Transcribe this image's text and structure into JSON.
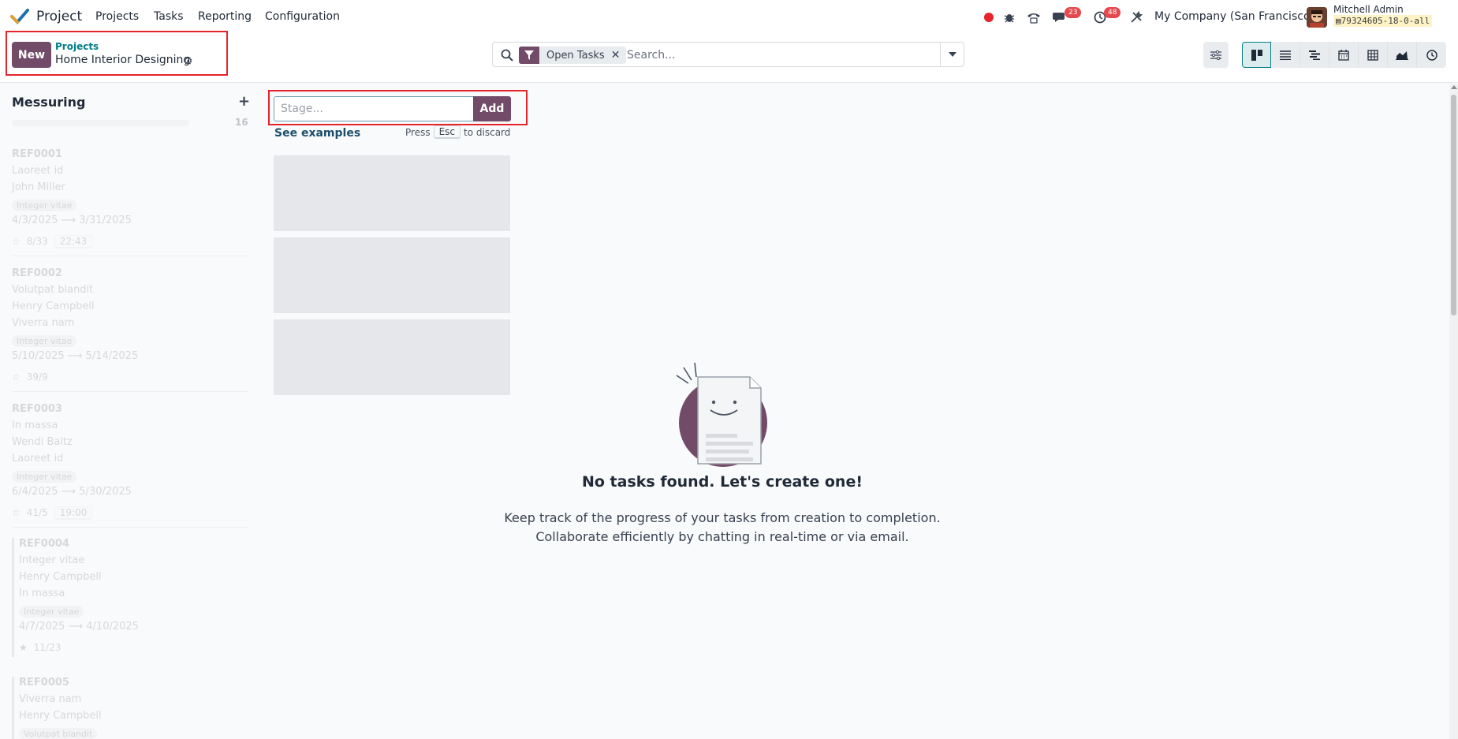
{
  "navbar": {
    "app_name": "Project",
    "menu": [
      "Projects",
      "Tasks",
      "Reporting",
      "Configuration"
    ],
    "messages_count": "23",
    "activities_count": "48",
    "company": "My Company (San Francisco)",
    "user_name": "Mitchell Admin",
    "database": "79324605-18-0-all"
  },
  "control_panel": {
    "new_label": "New",
    "breadcrumb_parent": "Projects",
    "breadcrumb_current": "Home Interior Designing",
    "search": {
      "facet_label": "Open Tasks",
      "placeholder": "Search..."
    }
  },
  "column": {
    "title": "Messuring",
    "count": "16",
    "cards": [
      {
        "ref": "REF0001",
        "line1": "Laoreet id",
        "line2": "John Miller",
        "tag": "Integer vitae",
        "dates": "4/3/2025 ⟶ 3/31/2025",
        "checklist": "8/33",
        "time": "22:43"
      },
      {
        "ref": "REF0002",
        "line1": "Volutpat blandit",
        "line2": "Henry Campbell",
        "line3": "Viverra nam",
        "tag": "Integer vitae",
        "dates": "5/10/2025 ⟶ 5/14/2025",
        "checklist": "39/9"
      },
      {
        "ref": "REF0003",
        "line1": "In massa",
        "line2": "Wendi Baltz",
        "line3": "Laoreet id",
        "tag": "Integer vitae",
        "dates": "6/4/2025 ⟶ 5/30/2025",
        "checklist": "41/5",
        "time": "19:00"
      },
      {
        "ref": "REF0004",
        "line1": "Integer vitae",
        "line2": "Henry Campbell",
        "line3": "In massa",
        "tag": "Integer vitae",
        "dates": "4/7/2025 ⟶ 4/10/2025",
        "checklist": "11/23"
      },
      {
        "ref": "REF0005",
        "line1": "Viverra nam",
        "line2": "Henry Campbell",
        "tag": "Volutpat blandit"
      }
    ]
  },
  "stage_form": {
    "placeholder": "Stage...",
    "add_label": "Add",
    "examples_link": "See examples",
    "hint_press": "Press",
    "hint_key": "Esc",
    "hint_tail": "to discard"
  },
  "empty_state": {
    "title": "No tasks found. Let's create one!",
    "line1": "Keep track of the progress of your tasks from creation to completion.",
    "line2": "Collaborate efficiently by chatting in real-time or via email."
  },
  "colors": {
    "brand": "#714b67",
    "link": "#017e84",
    "highlight": "#e5242e",
    "badge": "#e5484d"
  }
}
